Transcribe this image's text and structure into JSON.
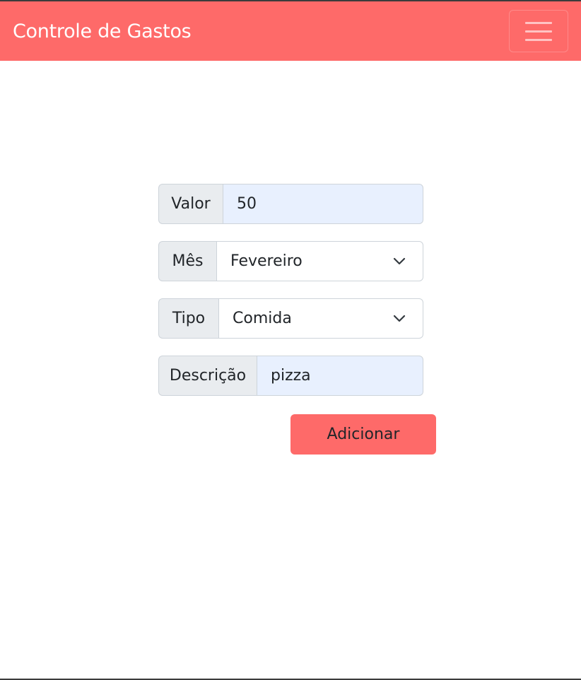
{
  "navbar": {
    "brand": "Controle de Gastos",
    "menu_icon": "hamburger-menu-icon",
    "background_color": "#fe6a69"
  },
  "form": {
    "valor": {
      "label": "Valor",
      "value": "50"
    },
    "mes": {
      "label": "Mês",
      "selected": "Fevereiro",
      "icon": "chevron-down-icon"
    },
    "tipo": {
      "label": "Tipo",
      "selected": "Comida",
      "icon": "chevron-down-icon"
    },
    "descricao": {
      "label": "Descrição",
      "value": "pizza"
    },
    "submit_label": "Adicionar",
    "autofill_color": "#e8f0fe",
    "addon_color": "#e9ecef"
  }
}
